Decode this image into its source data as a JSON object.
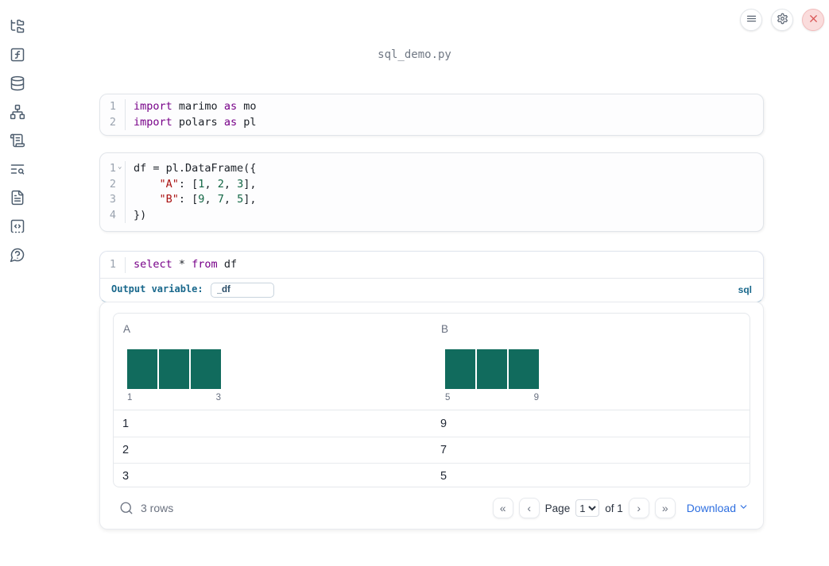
{
  "app": {
    "filename": "sql_demo.py"
  },
  "topbar": {
    "buttons": [
      "menu",
      "settings",
      "shutdown"
    ]
  },
  "sidebar": {
    "items": [
      "file-explorer",
      "variables",
      "datasources",
      "dependency-graph",
      "logs",
      "table-of-contents",
      "documentation",
      "snippets",
      "help"
    ]
  },
  "cells": [
    {
      "lines": [
        {
          "no": "1",
          "tokens": [
            {
              "t": "kw",
              "v": "import"
            },
            {
              "t": "pl",
              "v": " marimo "
            },
            {
              "t": "kw",
              "v": "as"
            },
            {
              "t": "pl",
              "v": " mo"
            }
          ]
        },
        {
          "no": "2",
          "tokens": [
            {
              "t": "kw",
              "v": "import"
            },
            {
              "t": "pl",
              "v": " polars "
            },
            {
              "t": "kw",
              "v": "as"
            },
            {
              "t": "pl",
              "v": " pl"
            }
          ]
        }
      ]
    },
    {
      "lines": [
        {
          "no": "1",
          "fold": true,
          "tokens": [
            {
              "t": "pl",
              "v": "df = pl.DataFrame({"
            }
          ]
        },
        {
          "no": "2",
          "tokens": [
            {
              "t": "pl",
              "v": "    "
            },
            {
              "t": "str",
              "v": "\"A\""
            },
            {
              "t": "pl",
              "v": ": ["
            },
            {
              "t": "num",
              "v": "1"
            },
            {
              "t": "pl",
              "v": ", "
            },
            {
              "t": "num",
              "v": "2"
            },
            {
              "t": "pl",
              "v": ", "
            },
            {
              "t": "num",
              "v": "3"
            },
            {
              "t": "pl",
              "v": "],"
            }
          ]
        },
        {
          "no": "3",
          "tokens": [
            {
              "t": "pl",
              "v": "    "
            },
            {
              "t": "str",
              "v": "\"B\""
            },
            {
              "t": "pl",
              "v": ": ["
            },
            {
              "t": "num",
              "v": "9"
            },
            {
              "t": "pl",
              "v": ", "
            },
            {
              "t": "num",
              "v": "7"
            },
            {
              "t": "pl",
              "v": ", "
            },
            {
              "t": "num",
              "v": "5"
            },
            {
              "t": "pl",
              "v": "],"
            }
          ]
        },
        {
          "no": "4",
          "tokens": [
            {
              "t": "pl",
              "v": "})"
            }
          ]
        }
      ]
    },
    {
      "lines": [
        {
          "no": "1",
          "tokens": [
            {
              "t": "kw",
              "v": "select"
            },
            {
              "t": "pl",
              "v": " * "
            },
            {
              "t": "kw",
              "v": "from"
            },
            {
              "t": "pl",
              "v": " df"
            }
          ]
        }
      ]
    }
  ],
  "sql_cell": {
    "output_variable_label": "Output variable:",
    "output_variable_value": "_df",
    "language_badge": "sql"
  },
  "table": {
    "columns": [
      {
        "name": "A",
        "hist": {
          "type": "bar",
          "values": [
            1,
            1,
            1
          ],
          "min_label": "1",
          "max_label": "3"
        }
      },
      {
        "name": "B",
        "hist": {
          "type": "bar",
          "values": [
            1,
            1,
            1
          ],
          "min_label": "5",
          "max_label": "9"
        }
      }
    ],
    "rows": [
      [
        "1",
        "9"
      ],
      [
        "2",
        "7"
      ],
      [
        "3",
        "5"
      ]
    ],
    "row_count_label": "3 rows",
    "pagination": {
      "first_glyph": "«",
      "prev_glyph": "‹",
      "next_glyph": "›",
      "last_glyph": "»",
      "page_label": "Page",
      "page_value": "1",
      "of_label": "of 1"
    },
    "download_label": "Download"
  },
  "colors": {
    "bar_teal": "#116b5d",
    "sql_label_blue": "#19688c",
    "download_blue": "#2e6fe0",
    "keyword_purple": "#770088",
    "string_red": "#aa1111",
    "number_green": "#116644",
    "close_red": "#d95757"
  }
}
